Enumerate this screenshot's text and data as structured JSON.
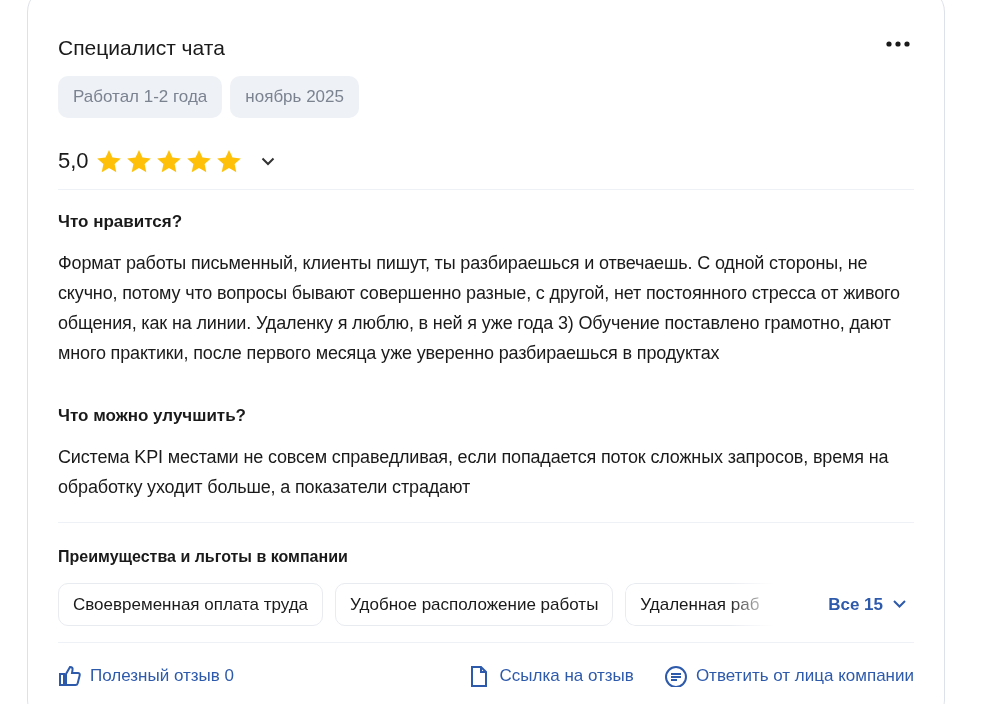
{
  "review": {
    "title": "Специалист чата",
    "tags": [
      "Работал 1-2 года",
      "ноябрь 2025"
    ],
    "rating": "5,0",
    "stars": 5,
    "sections": [
      {
        "heading": "Что нравится?",
        "text": "Формат работы письменный, клиенты пишут, ты разбираешься и отвечаешь. С одной стороны, не скучно, потому что вопросы бывают совершенно разные, с другой, нет постоянного стресса от живого общения, как на линии. Удаленку я люблю, в ней я уже года 3) Обучение поставлено грамотно, дают много практики, после первого месяца уже уверенно разбираешься в продуктах"
      },
      {
        "heading": "Что можно улучшить?",
        "text": "Система KPI местами не совсем справедливая, если попадается поток сложных запросов, время на обработку уходит больше, а показатели страдают"
      }
    ],
    "benefits": {
      "title": "Преимущества и льготы в компании",
      "items": [
        "Своевременная оплата труда",
        "Удобное расположение работы",
        "Удаленная раб"
      ],
      "more": "Все 15"
    },
    "actions": [
      {
        "kind": "like",
        "label": "Полезный отзыв 0"
      },
      {
        "kind": "link",
        "label": "Ссылка на отзыв"
      },
      {
        "kind": "reply",
        "label": "Ответить от лица компании"
      }
    ]
  }
}
